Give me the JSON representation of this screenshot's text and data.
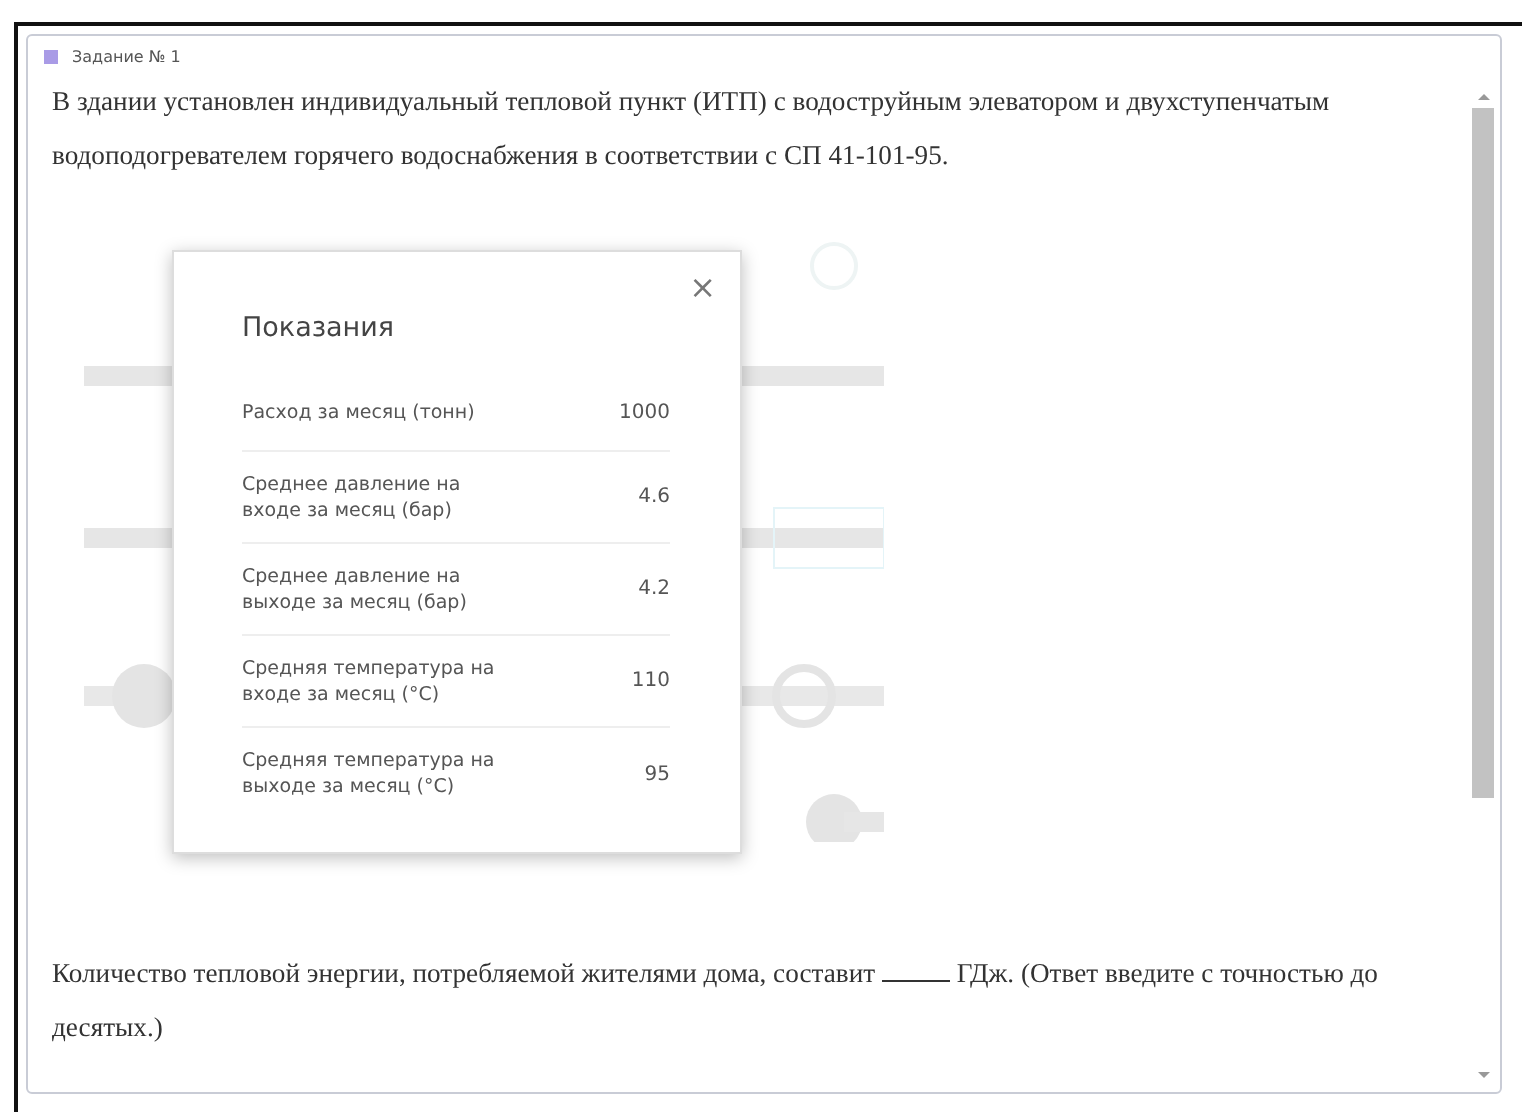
{
  "task": {
    "label": "Задание № 1"
  },
  "question": "В здании установлен индивидуальный тепловой пункт (ИТП) с водоструйным элеватором и двухступенчатым водоподогревателем горячего водоснабжения в соответствии с СП 41-101-95.",
  "modal": {
    "title": "Показания",
    "close": "×",
    "rows": [
      {
        "label": "Расход за месяц (тонн)",
        "value": "1000"
      },
      {
        "label": "Среднее давление на входе за месяц (бар)",
        "value": "4.6"
      },
      {
        "label": "Среднее давление на выходе за месяц (бар)",
        "value": "4.2"
      },
      {
        "label": "Средняя температура на входе за месяц (°C)",
        "value": "110"
      },
      {
        "label": "Средняя температура на выходе за месяц (°C)",
        "value": "95"
      }
    ]
  },
  "answer_prompt": {
    "before": "Количество тепловой энергии, потребляемой жителями дома, составит",
    "after": "ГДж. (Ответ введите с точностью до десятых.)"
  }
}
